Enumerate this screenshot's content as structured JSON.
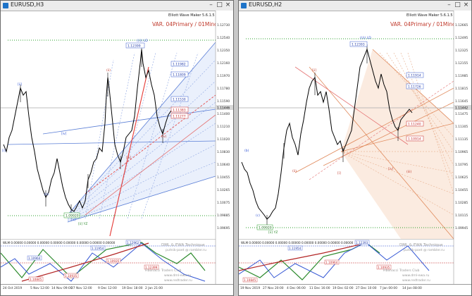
{
  "windows": [
    {
      "title": "EURUSD,H3",
      "indicator_name": "Elliott Wave Maker 5.6.1.5",
      "var_label": "VAR. 04Primary / 01Minor",
      "price_labels": [
        "1.12730",
        "1.12540",
        "1.12350",
        "1.12160",
        "1.11970",
        "1.11780",
        "1.11590",
        "1.11400",
        "1.11210",
        "1.11020",
        "1.10830",
        "1.10640",
        "1.10455",
        "1.10265",
        "1.10075",
        "1.09885",
        "1.09695"
      ],
      "current_price": "1.11446",
      "level_boxes": [
        "1.12399",
        "1.11982",
        "1.11809",
        "1.11530",
        "1.11383",
        "1.11277",
        "1.09920"
      ],
      "wave_labels": [
        "((i)) LD",
        "[ii]",
        "[iv]",
        "[i]",
        "(c)",
        "[v]",
        "[ii] YZ",
        "(ii)",
        "[iii]",
        "(iv)"
      ],
      "date_labels": [
        "24 Oct 2019",
        "5 Nov 12:00",
        "14 Nov 09:00",
        "27 Nov 12:00",
        "9 Dec 12:00",
        "19 Dec 18:00",
        "2 Jan 21:00"
      ],
      "sub_label": "WLM 0.00000 0.00000 0.00000 0.00000 0.00000 0.00000 0.00000 0.00000",
      "sub_values": [
        "1.12962",
        "1.11954",
        "1.10964",
        "1.10935",
        "1.10935",
        "1.12399",
        "1.10845"
      ],
      "watermark": [
        "DML & EWA Technique",
        "putnik-poet @ rambler.ru",
        "Fibonacci    Traders    Club",
        "www.dml-ewa.ru",
        "www.redtrader.ru"
      ]
    },
    {
      "title": "EURUSD,H2",
      "indicator_name": "Elliott Wave Maker 5.6.1.5",
      "var_label": "VAR. 04Primary / 01Minor",
      "price_labels": [
        "1.12665",
        "1.12495",
        "1.12325",
        "1.12155",
        "1.11985",
        "1.11815",
        "1.11645",
        "1.11475",
        "1.11305",
        "1.11135",
        "1.10965",
        "1.10795",
        "1.10625",
        "1.10455",
        "1.10285",
        "1.10115",
        "1.09945"
      ],
      "current_price": "1.11442",
      "level_boxes": [
        "1.12393",
        "1.11914",
        "1.11726",
        "1.11240",
        "1.10914",
        "1.09920"
      ],
      "wave_labels": [
        "((i)) LD",
        "[ii]",
        "(b)",
        "[i]",
        "(c)",
        "[ii] YZ",
        "(ii)",
        "[iv]",
        "(iii)"
      ],
      "date_labels": [
        "19 Nov 2019",
        "27 Nov 20:00",
        "4 Dec 06:00",
        "11 Dec 16:00",
        "19 Dec 02:00",
        "27 Dec 10:00",
        "7 Jan 00:00",
        "14 Jan 08:00"
      ],
      "sub_label": "WLM 0.00000 0.00000 0.00000 0.00000 0.00000 0.00000 0.00000 0.00000",
      "sub_values": [
        "1.12393",
        "1.11954",
        "1.10964",
        "1.10935",
        "1.10845"
      ],
      "watermark": [
        "DML & EWA Technique",
        "putnik-poet @ rambler.ru",
        "Fibonacci    Traders    Club",
        "www.dml-ewa.ru",
        "www.redtrader.ru"
      ]
    }
  ],
  "colors": {
    "candle": "#000000",
    "fork_blue": "#5b7fd6",
    "fork_fill_blue": "#e8eefc",
    "fork_orange": "#e08a5c",
    "fork_fill_orange": "#fbe9dd",
    "red_line": "#e53935",
    "green_dotted": "#2ea02e",
    "level_box_border": "#3a5ecf",
    "level_box_text": "#2039a8",
    "red_box_text": "#c62828",
    "var_text": "#c0392b",
    "sub_green": "#2e8b2e",
    "sub_blue": "#3356d4",
    "sub_red": "#c62828"
  }
}
